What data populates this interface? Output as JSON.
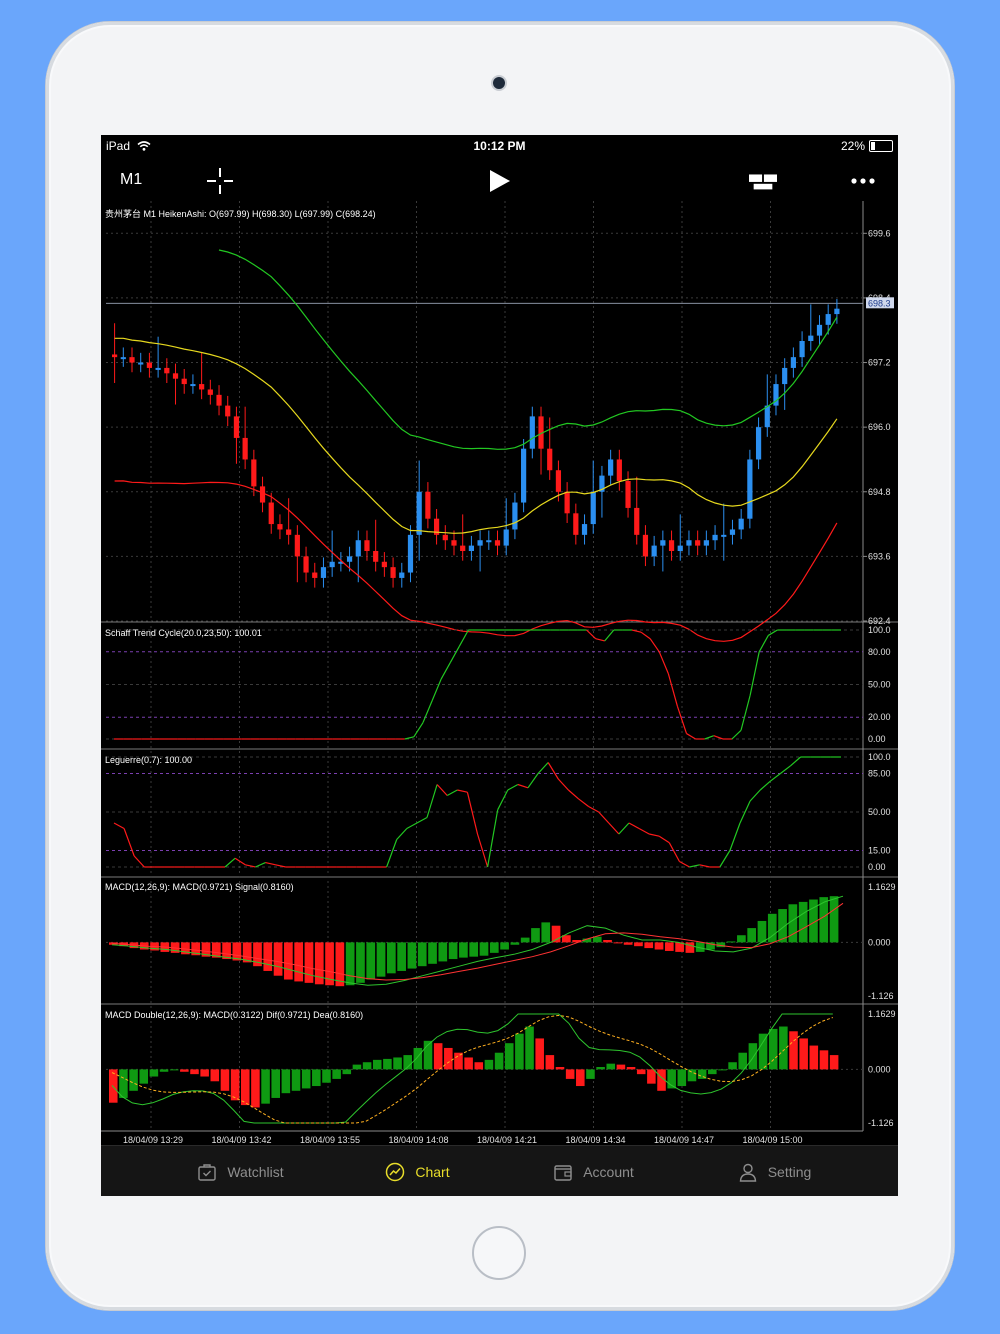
{
  "status_bar": {
    "device": "iPad",
    "time": "10:12 PM",
    "battery": "22%"
  },
  "toolbar": {
    "timeframe": "M1"
  },
  "main_chart": {
    "label": "贵州茅台 M1 HeikenAshi: O(697.99) H(698.30) L(697.99) C(698.24)",
    "price_ticks": [
      "699.6",
      "698.4",
      "697.2",
      "696.0",
      "694.8",
      "693.6",
      "692.4"
    ],
    "current_price": "698.3",
    "time_ticks": [
      "18/04/09 13:29",
      "18/04/09 13:42",
      "18/04/09 13:55",
      "18/04/09 14:08",
      "18/04/09 14:21",
      "18/04/09 14:34",
      "18/04/09 14:47",
      "18/04/09 15:00"
    ]
  },
  "indicators": {
    "schaff": {
      "label": "Schaff Trend Cycle(20.0,23,50): 100.01",
      "ticks": [
        "100.0",
        "80.00",
        "50.00",
        "20.00",
        "0.00"
      ]
    },
    "leguerre": {
      "label": "Leguerre(0.7): 100.00",
      "ticks": [
        "100.0",
        "85.00",
        "50.00",
        "15.00",
        "0.00"
      ]
    },
    "macd": {
      "label": "MACD(12,26,9): MACD(0.9721) Signal(0.8160)",
      "ticks": [
        "1.1629",
        "0.000",
        "-1.126"
      ]
    },
    "macd_double": {
      "label": "MACD Double(12,26,9): MACD(0.3122) Dif(0.9721) Dea(0.8160)",
      "ticks": [
        "1.1629",
        "0.000",
        "-1.126"
      ]
    }
  },
  "colors": {
    "bull": "#2b8ff0",
    "bear": "#ff1a1a",
    "band_upper": "#22c822",
    "band_mid": "#e6d81e",
    "tab_active": "#e8dd2a",
    "background": "#000000"
  },
  "tabs": [
    {
      "label": "Watchlist",
      "icon": "briefcase-icon"
    },
    {
      "label": "Chart",
      "icon": "chart-icon",
      "active": true
    },
    {
      "label": "Account",
      "icon": "wallet-icon"
    },
    {
      "label": "Setting",
      "icon": "user-icon"
    }
  ],
  "chart_data": [
    {
      "type": "candlestick",
      "title": "贵州茅台 M1 HeikenAshi: O(697.99) H(698.30) L(697.99) C(698.24)",
      "ylim": [
        692.4,
        700.2
      ],
      "x_labels": [
        "18/04/09 13:29",
        "18/04/09 13:42",
        "18/04/09 13:55",
        "18/04/09 14:08",
        "18/04/09 14:21",
        "18/04/09 14:34",
        "18/04/09 14:47",
        "18/04/09 15:00"
      ],
      "close_values": [
        697.3,
        697.3,
        697.2,
        697.2,
        697.1,
        697.1,
        697.0,
        696.9,
        696.8,
        696.8,
        696.7,
        696.6,
        696.4,
        696.2,
        695.8,
        695.4,
        694.9,
        694.6,
        694.2,
        694.1,
        694.0,
        693.6,
        693.3,
        693.2,
        693.4,
        693.5,
        693.5,
        693.6,
        693.9,
        693.7,
        693.5,
        693.4,
        693.2,
        693.3,
        694.0,
        694.8,
        694.3,
        694.0,
        693.9,
        693.8,
        693.7,
        693.8,
        693.9,
        693.9,
        693.8,
        694.1,
        694.6,
        695.6,
        696.2,
        695.6,
        695.2,
        694.8,
        694.4,
        694.0,
        694.2,
        694.8,
        695.1,
        695.4,
        695.0,
        694.5,
        694.0,
        693.6,
        693.8,
        693.9,
        693.7,
        693.8,
        693.9,
        693.8,
        693.9,
        694.0,
        694.0,
        694.1,
        694.3,
        695.4,
        696.0,
        696.4,
        696.8,
        697.1,
        697.3,
        697.6,
        697.7,
        697.9,
        698.1,
        698.2
      ]
    },
    {
      "type": "line",
      "title": "Schaff Trend Cycle(20.0,23,50): 100.01",
      "ylim": [
        0,
        100
      ],
      "values": [
        0,
        0,
        0,
        0,
        0,
        0,
        0,
        0,
        0,
        0,
        0,
        0,
        0,
        0,
        0,
        0,
        0,
        0,
        0,
        0,
        0,
        0,
        0,
        0,
        0,
        0,
        0,
        0,
        0,
        0,
        0,
        0,
        0,
        2,
        15,
        35,
        55,
        70,
        85,
        100,
        100,
        100,
        100,
        100,
        100,
        100,
        100,
        100,
        100,
        100,
        100,
        100,
        100,
        92,
        90,
        100,
        100,
        100,
        98,
        92,
        80,
        60,
        30,
        5,
        0,
        0,
        3,
        0,
        0,
        8,
        40,
        80,
        95,
        100,
        100,
        100,
        100,
        100,
        100,
        100,
        100
      ]
    },
    {
      "type": "line",
      "title": "Leguerre(0.7): 100.00",
      "ylim": [
        0,
        100
      ],
      "values": [
        40,
        35,
        10,
        0,
        0,
        0,
        0,
        0,
        0,
        0,
        0,
        0,
        8,
        2,
        0,
        4,
        2,
        0,
        0,
        0,
        0,
        0,
        0,
        0,
        0,
        0,
        0,
        0,
        25,
        35,
        40,
        45,
        75,
        65,
        70,
        68,
        30,
        0,
        52,
        70,
        75,
        72,
        85,
        95,
        80,
        70,
        62,
        55,
        50,
        40,
        30,
        40,
        35,
        30,
        28,
        22,
        5,
        0,
        2,
        0,
        0,
        15,
        40,
        60,
        70,
        78,
        85,
        92,
        100,
        100,
        100,
        100,
        100
      ]
    },
    {
      "type": "bar",
      "title": "MACD(12,26,9): MACD(0.9721) Signal(0.8160)",
      "ylim": [
        -1.126,
        1.1629
      ],
      "values": [
        -0.05,
        -0.08,
        -0.12,
        -0.15,
        -0.17,
        -0.2,
        -0.22,
        -0.25,
        -0.27,
        -0.3,
        -0.32,
        -0.35,
        -0.38,
        -0.42,
        -0.5,
        -0.6,
        -0.7,
        -0.78,
        -0.82,
        -0.85,
        -0.88,
        -0.9,
        -0.92,
        -0.9,
        -0.85,
        -0.78,
        -0.72,
        -0.65,
        -0.6,
        -0.55,
        -0.5,
        -0.45,
        -0.4,
        -0.35,
        -0.32,
        -0.3,
        -0.28,
        -0.22,
        -0.15,
        -0.05,
        0.1,
        0.3,
        0.42,
        0.35,
        0.15,
        0.05,
        0.08,
        0.12,
        0.05,
        0.0,
        -0.05,
        -0.08,
        -0.12,
        -0.15,
        -0.18,
        -0.2,
        -0.22,
        -0.2,
        -0.15,
        -0.1,
        0.02,
        0.15,
        0.3,
        0.45,
        0.6,
        0.7,
        0.8,
        0.85,
        0.9,
        0.95,
        0.97
      ],
      "series": [
        {
          "name": "MACD",
          "values": [
            -0.05,
            -0.08,
            -0.12,
            -0.15,
            -0.2,
            -0.25,
            -0.3,
            -0.35,
            -0.42,
            -0.5,
            -0.6,
            -0.7,
            -0.78,
            -0.85,
            -0.9,
            -0.88,
            -0.8,
            -0.7,
            -0.6,
            -0.5,
            -0.4,
            -0.32,
            -0.25,
            -0.15,
            0.0,
            0.2,
            0.35,
            0.3,
            0.15,
            0.05,
            0.05,
            0.0,
            -0.1,
            -0.18,
            -0.2,
            -0.12,
            0.1,
            0.4,
            0.65,
            0.85,
            0.97
          ]
        },
        {
          "name": "Signal",
          "values": [
            -0.02,
            -0.05,
            -0.08,
            -0.1,
            -0.14,
            -0.18,
            -0.23,
            -0.28,
            -0.34,
            -0.4,
            -0.47,
            -0.55,
            -0.62,
            -0.7,
            -0.76,
            -0.79,
            -0.78,
            -0.74,
            -0.68,
            -0.61,
            -0.54,
            -0.46,
            -0.38,
            -0.3,
            -0.2,
            -0.07,
            0.07,
            0.18,
            0.2,
            0.17,
            0.12,
            0.08,
            0.02,
            -0.05,
            -0.1,
            -0.11,
            -0.03,
            0.12,
            0.33,
            0.55,
            0.82
          ]
        }
      ]
    },
    {
      "type": "bar",
      "title": "MACD Double(12,26,9): MACD(0.3122) Dif(0.9721) Dea(0.8160)",
      "ylim": [
        -1.126,
        1.1629
      ],
      "values": [
        -0.7,
        -0.6,
        -0.45,
        -0.3,
        -0.15,
        -0.05,
        0.0,
        -0.05,
        -0.1,
        -0.15,
        -0.25,
        -0.45,
        -0.65,
        -0.75,
        -0.8,
        -0.72,
        -0.6,
        -0.5,
        -0.45,
        -0.4,
        -0.35,
        -0.28,
        -0.2,
        -0.1,
        0.1,
        0.15,
        0.2,
        0.22,
        0.25,
        0.3,
        0.45,
        0.6,
        0.55,
        0.45,
        0.35,
        0.25,
        0.15,
        0.2,
        0.35,
        0.55,
        0.75,
        0.9,
        0.65,
        0.3,
        0.05,
        -0.2,
        -0.35,
        -0.2,
        0.05,
        0.12,
        0.1,
        0.05,
        -0.1,
        -0.3,
        -0.45,
        -0.4,
        -0.35,
        -0.25,
        -0.2,
        -0.1,
        0.0,
        0.15,
        0.35,
        0.55,
        0.75,
        0.85,
        0.9,
        0.8,
        0.65,
        0.5,
        0.4,
        0.3
      ]
    }
  ]
}
